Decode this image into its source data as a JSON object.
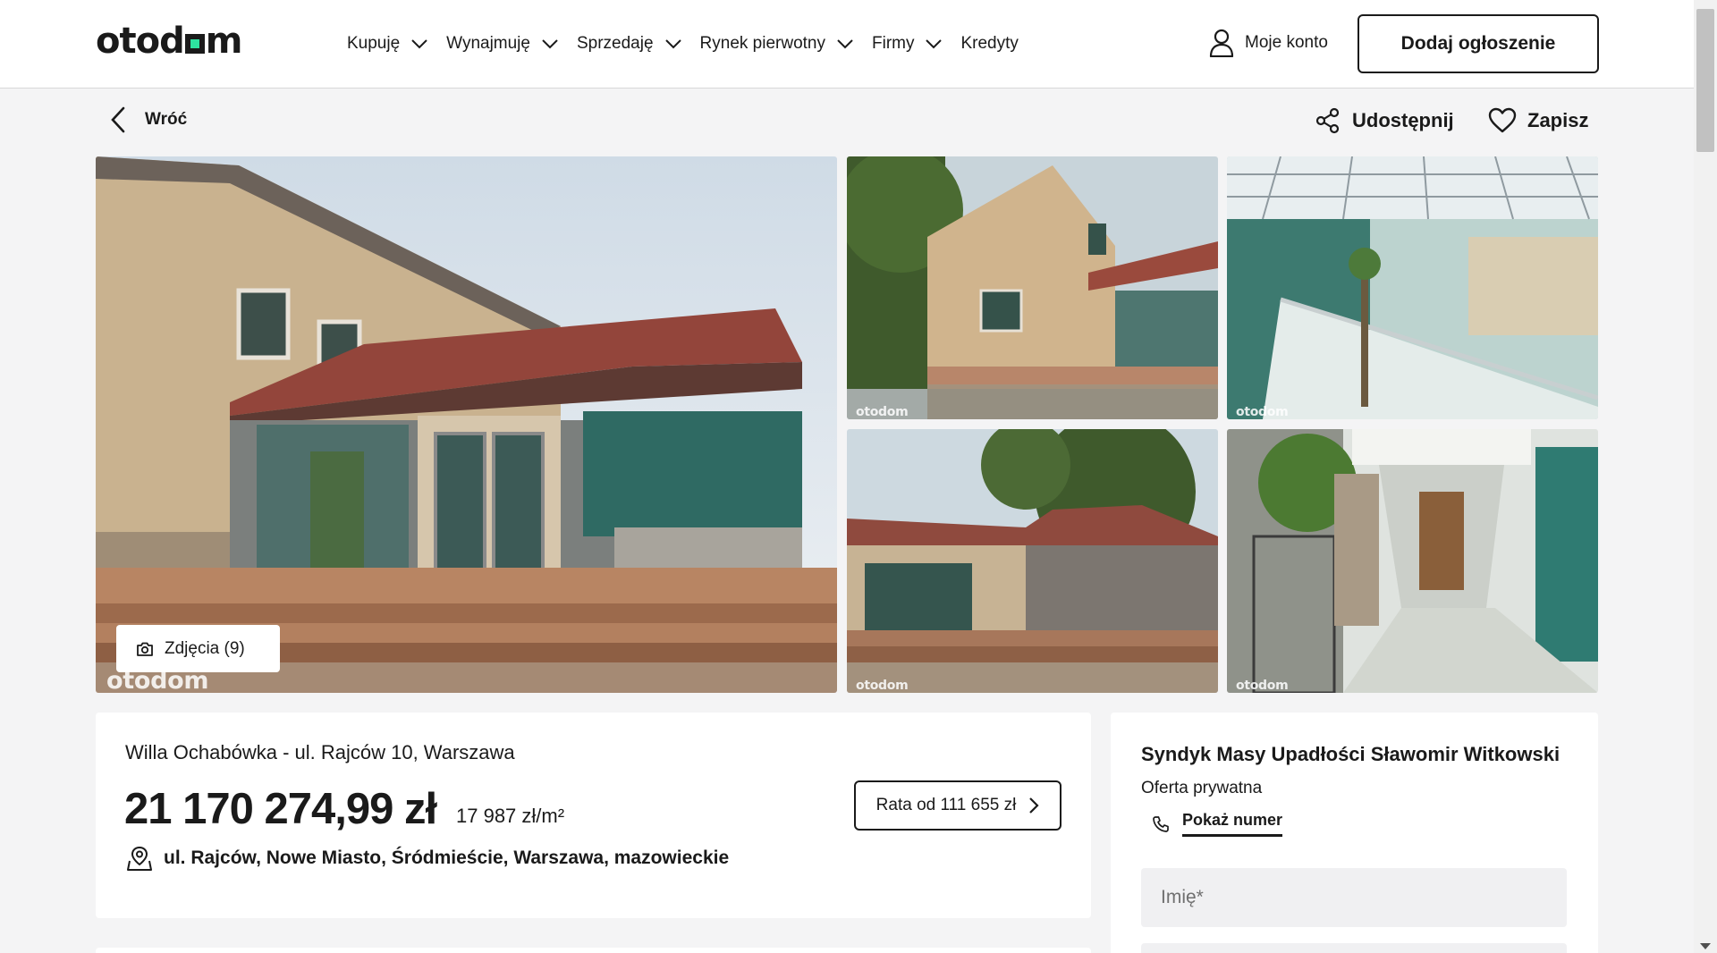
{
  "header": {
    "logo": {
      "pre": "otod",
      "post": "m"
    },
    "nav": [
      {
        "label": "Kupuję",
        "has_dropdown": true
      },
      {
        "label": "Wynajmuję",
        "has_dropdown": true
      },
      {
        "label": "Sprzedaję",
        "has_dropdown": true
      },
      {
        "label": "Rynek pierwotny",
        "has_dropdown": true
      },
      {
        "label": "Firmy",
        "has_dropdown": true
      },
      {
        "label": "Kredyty",
        "has_dropdown": false
      }
    ],
    "account_label": "Moje konto",
    "add_listing_label": "Dodaj ogłoszenie"
  },
  "subbar": {
    "back_label": "Wróć",
    "share_label": "Udostępnij",
    "save_label": "Zapisz"
  },
  "gallery": {
    "photos_button_label": "Zdjęcia (9)",
    "watermark": "otodom"
  },
  "listing": {
    "title": "Willa Ochabówka - ul. Rajców 10, Warszawa",
    "price": "21 170 274,99 zł",
    "price_per_m2": "17 987 zł/m²",
    "installment_label": "Rata od 111 655 zł",
    "address": "ul. Rajców, Nowe Miasto, Śródmieście, Warszawa, mazowieckie"
  },
  "contact": {
    "seller_name": "Syndyk Masy Upadłości Sławomir Witkowski",
    "offer_type": "Oferta prywatna",
    "show_number_label": "Pokaż numer",
    "name_placeholder": "Imię*"
  },
  "colors": {
    "brand_accent": "#2ee3a0",
    "text": "#1a1a1a",
    "page_bg": "#f4f4f5"
  }
}
